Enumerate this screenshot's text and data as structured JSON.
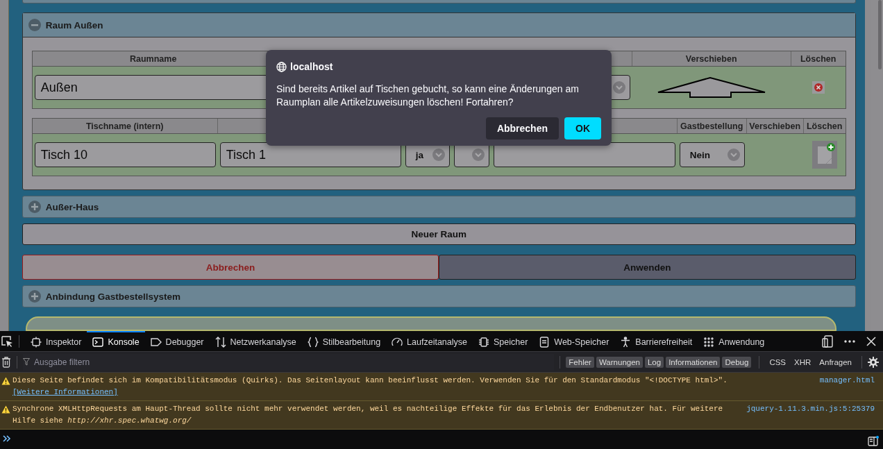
{
  "room_panel": {
    "title": "Raum Außen",
    "expanded": true,
    "room_table": {
      "columns": [
        "Raumname",
        "Verschieben",
        "Löschen"
      ],
      "cells": [
        {
          "kind": "input",
          "value": "Außen"
        },
        {
          "kind": "empty"
        },
        {
          "kind": "select"
        },
        {
          "kind": "move"
        },
        {
          "kind": "delete"
        }
      ]
    },
    "table_table": {
      "columns": [
        "Tischname (intern)",
        "Gastbestellung",
        "Verschieben",
        "Löschen"
      ],
      "cells": [
        {
          "kind": "input",
          "value": "Tisch 10"
        },
        {
          "kind": "input",
          "value": "Tisch 1"
        },
        {
          "kind": "select",
          "value": "ja"
        },
        {
          "kind": "select"
        },
        {
          "kind": "input"
        },
        {
          "kind": "select",
          "value": "Nein"
        },
        {
          "kind": "empty"
        },
        {
          "kind": "add"
        }
      ]
    }
  },
  "other_panel": {
    "title": "Außer-Haus",
    "expanded": false
  },
  "new_room_button": "Neuer Raum",
  "action_buttons": [
    {
      "label": "Abbrechen",
      "kind": "cancel"
    },
    {
      "label": "Anwenden",
      "kind": "apply"
    }
  ],
  "bottom_panel": {
    "title": "Anbindung Gastbestellsystem",
    "expanded": false
  },
  "dialog": {
    "origin": "localhost",
    "message": "Sind bereits Artikel auf Tischen gebucht, so kann eine Änderungen am Raumplan alle Artikelzuweisungen löschen! Fortahren?",
    "buttons": [
      {
        "label": "Abbrechen",
        "kind": "secondary"
      },
      {
        "label": "OK",
        "kind": "primary"
      }
    ]
  },
  "devtools": {
    "tabs": [
      {
        "label": "Inspektor",
        "selected": false
      },
      {
        "label": "Konsole",
        "selected": true
      },
      {
        "label": "Debugger",
        "selected": false
      },
      {
        "label": "Netzwerkanalyse",
        "selected": false
      },
      {
        "label": "Stilbearbeitung",
        "selected": false
      },
      {
        "label": "Laufzeitanalyse",
        "selected": false
      },
      {
        "label": "Speicher",
        "selected": false
      },
      {
        "label": "Web-Speicher",
        "selected": false
      },
      {
        "label": "Barrierefreiheit",
        "selected": false
      },
      {
        "label": "Anwendung",
        "selected": false
      }
    ],
    "filter": {
      "placeholder": "Ausgabe filtern"
    },
    "levels": [
      "Fehler",
      "Warnungen",
      "Log",
      "Informationen",
      "Debug"
    ],
    "request_filters": [
      "CSS",
      "XHR",
      "Anfragen"
    ],
    "messages": [
      {
        "text": "Diese Seite befindet sich im Kompatibilitätsmodus (Quirks). Das Seitenlayout kann beeinflusst werden. Verwenden Sie für den Standardmodus \"<!DOCTYPE html>\".",
        "link": "[Weitere Informationen]",
        "source": "manager.html"
      },
      {
        "text": "Synchrone XMLHttpRequests am Haupt-Thread sollte nicht mehr verwendet werden, weil es nachteilige Effekte für das Erlebnis der Endbenutzer hat. Für weitere Hilfe siehe *http://xhr.spec.whatwg.org/*",
        "source": "jquery-1.11.3.min.js:5:25379"
      }
    ]
  }
}
